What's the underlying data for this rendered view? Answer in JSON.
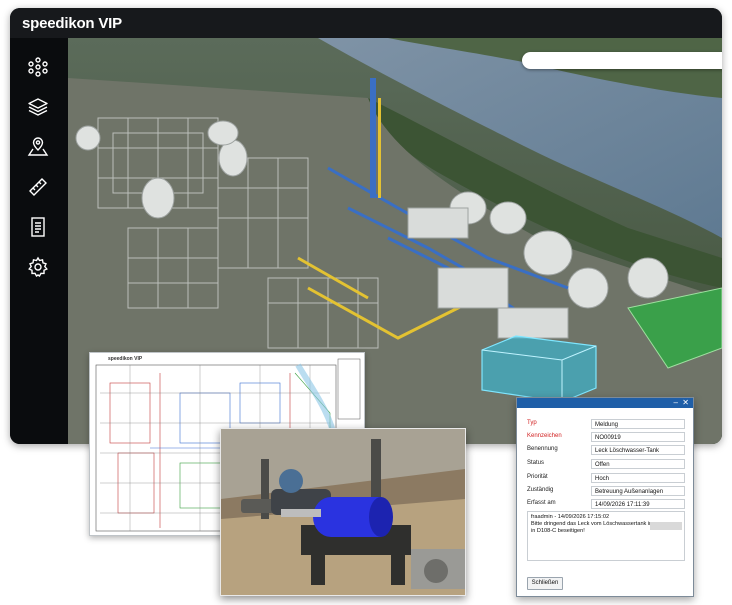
{
  "app": {
    "title": "speedikon VIP",
    "search": {
      "placeholder": "",
      "icon": "search-icon"
    },
    "sidebar": [
      {
        "icon": "network-icon"
      },
      {
        "icon": "layers-icon"
      },
      {
        "icon": "map-pin-icon"
      },
      {
        "icon": "ruler-icon"
      },
      {
        "icon": "document-icon"
      },
      {
        "icon": "gear-icon"
      }
    ]
  },
  "plan_card": {
    "logo": "speedikon VIP"
  },
  "dialog": {
    "fields": [
      {
        "label": "Typ",
        "value": "Meldung",
        "required": true
      },
      {
        "label": "Kennzeichen",
        "value": "NO00919",
        "required": true
      },
      {
        "label": "Benennung",
        "value": "Leck Löschwasser-Tank",
        "required": false
      },
      {
        "label": "Status",
        "value": "Offen",
        "required": false
      },
      {
        "label": "Priorität",
        "value": "Hoch",
        "required": false
      },
      {
        "label": "Zuständig",
        "value": "Betreuung Außenanlagen",
        "required": false
      },
      {
        "label": "Erfasst am",
        "value": "14/09/2026 17:11:39",
        "required": false
      }
    ],
    "comment": [
      "fraadmin - 14/09/2026 17:15:02",
      "Bitte dringend das Leck vom Löschwassertank in",
      "in D108-C beseitigen!"
    ],
    "close_label": "Schließen"
  },
  "colors": {
    "dialog_bar": "#1f5fa8",
    "required_label": "#d11f1f",
    "highlight_building": "#2ec4e8"
  }
}
